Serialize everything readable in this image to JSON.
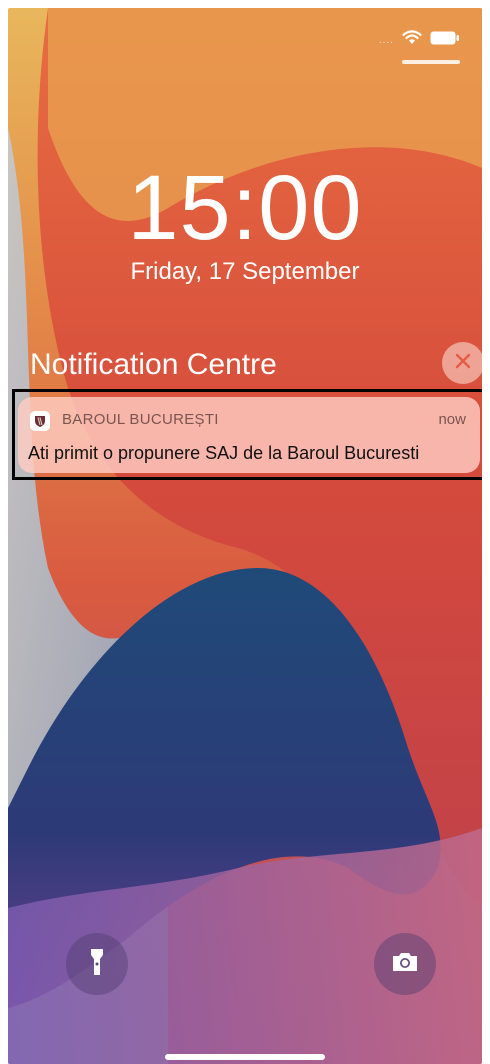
{
  "lock_screen": {
    "time": "15:00",
    "date": "Friday, 17 September"
  },
  "status_bar": {
    "dots": "....",
    "icons": [
      "wifi-icon",
      "battery-icon"
    ]
  },
  "notification_centre": {
    "title": "Notification Centre",
    "close_icon": "close-icon"
  },
  "notification": {
    "app_name": "BAROUL BUCUREȘTI",
    "time": "now",
    "message": "Ati primit o propunere SAJ de la Baroul Bucuresti",
    "app_icon": "baroul-logo-icon"
  },
  "quick_actions": {
    "left": "flashlight-icon",
    "right": "camera-icon"
  },
  "colors": {
    "wallpaper_top": "#e8b25a",
    "wallpaper_orange": "#e4603c",
    "wallpaper_red": "#cf4a3e",
    "wallpaper_blue": "#2b3f78",
    "wallpaper_purple": "#8a4fa0",
    "notification_bg": "#ffcdc3",
    "close_button_x": "#e45b48"
  }
}
